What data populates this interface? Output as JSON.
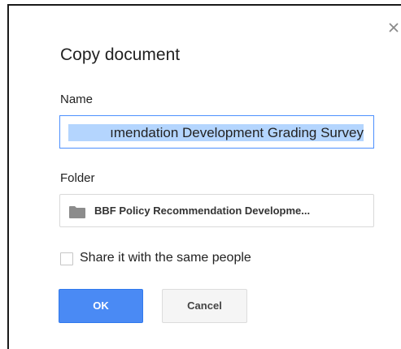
{
  "dialog": {
    "title": "Copy document",
    "close_icon": "close-icon"
  },
  "name": {
    "label": "Name",
    "value": "ımendation Development Grading Survey"
  },
  "folder": {
    "label": "Folder",
    "icon": "folder-icon",
    "value": "BBF Policy Recommendation Developme..."
  },
  "share": {
    "label": "Share it with the same people",
    "checked": false
  },
  "buttons": {
    "ok_label": "OK",
    "cancel_label": "Cancel"
  },
  "colors": {
    "primary_button": "#4a8af4",
    "input_focus_border": "#4d90fe",
    "selection_highlight": "#b4d5fe"
  }
}
